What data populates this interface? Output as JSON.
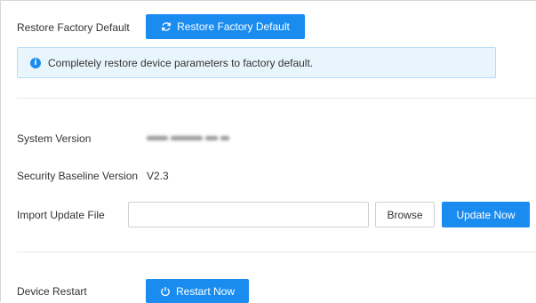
{
  "restore": {
    "label": "Restore Factory Default",
    "button_label": "Restore Factory Default",
    "notice": "Completely restore device parameters to factory default."
  },
  "system_version": {
    "label": "System Version"
  },
  "security_baseline": {
    "label": "Security Baseline Version",
    "value": "V2.3"
  },
  "import_update": {
    "label": "Import Update File",
    "file_value": "",
    "browse_label": "Browse",
    "update_label": "Update Now"
  },
  "restart": {
    "label": "Device Restart",
    "button_label": "Restart Now"
  },
  "colors": {
    "primary": "#1a8cf0",
    "notice_bg": "#e9f5fd",
    "notice_border": "#b6dcf5"
  },
  "icons": [
    "refresh-icon",
    "info-icon",
    "power-icon"
  ]
}
